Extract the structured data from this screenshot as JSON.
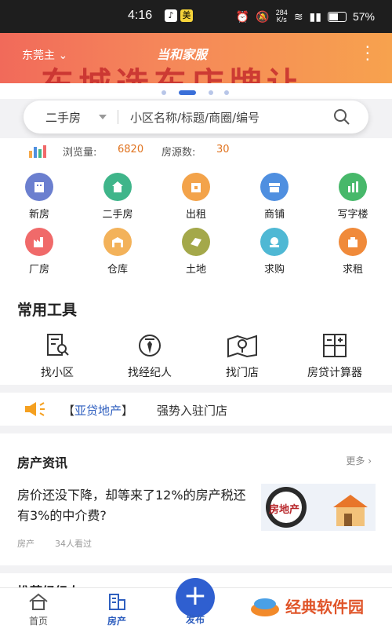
{
  "status_bar": {
    "time": "4:16",
    "net_speed": "284",
    "net_unit": "K/s",
    "battery": "57%"
  },
  "banner": {
    "city": "东莞主",
    "slogan": "当和家服",
    "headline": "东城选东店牌让"
  },
  "search": {
    "type": "二手房",
    "placeholder": "小区名称/标题/商圈/编号"
  },
  "stats": {
    "views_label": "浏览量:",
    "views_value": "6820",
    "listings_label": "房源数:",
    "listings_value": "30"
  },
  "categories": [
    {
      "label": "新房",
      "color": "#6b7fcf",
      "icon": "building-icon"
    },
    {
      "label": "二手房",
      "color": "#3fb58a",
      "icon": "house-icon"
    },
    {
      "label": "出租",
      "color": "#f3a34a",
      "icon": "rent-icon"
    },
    {
      "label": "商铺",
      "color": "#4f8fe0",
      "icon": "shop-icon"
    },
    {
      "label": "写字楼",
      "color": "#47b86a",
      "icon": "office-icon"
    },
    {
      "label": "厂房",
      "color": "#f06a6a",
      "icon": "factory-icon"
    },
    {
      "label": "仓库",
      "color": "#f3b25a",
      "icon": "warehouse-icon"
    },
    {
      "label": "土地",
      "color": "#a4a84a",
      "icon": "land-icon"
    },
    {
      "label": "求购",
      "color": "#4fb8d4",
      "icon": "buy-request-icon"
    },
    {
      "label": "求租",
      "color": "#f08a3a",
      "icon": "rent-request-icon"
    }
  ],
  "tools": {
    "title": "常用工具",
    "items": [
      {
        "label": "找小区",
        "icon": "find-community-icon"
      },
      {
        "label": "找经纪人",
        "icon": "find-agent-icon"
      },
      {
        "label": "找门店",
        "icon": "find-store-icon"
      },
      {
        "label": "房贷计算器",
        "icon": "calculator-icon"
      }
    ]
  },
  "notice": {
    "tag_open": "【",
    "tag": "亚贷地产",
    "tag_close": "】",
    "text": "强势入驻门店"
  },
  "news": {
    "title": "房产资讯",
    "more": "更多",
    "headline": "房价还没下降，却等来了12%的房产税还有3%的中介费?",
    "category": "房产",
    "views": "34人看过",
    "thumb_text": "房地产"
  },
  "agents": {
    "title": "推荐经纪人"
  },
  "tabbar": {
    "items": [
      {
        "label": "首页"
      },
      {
        "label": "房产"
      }
    ],
    "publish": "发布"
  },
  "watermark": "经典软件园",
  "colors": {
    "accent": "#2f5fbf",
    "highlight": "#e0731f"
  }
}
